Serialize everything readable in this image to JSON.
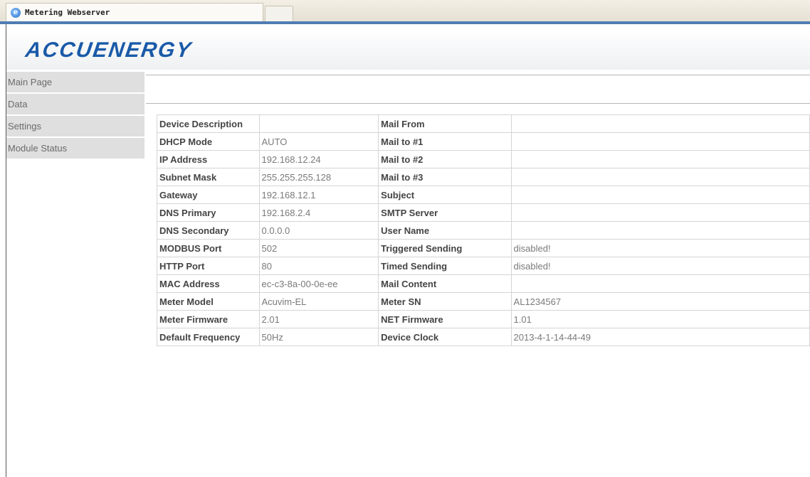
{
  "browser": {
    "tab_title": "Metering Webserver",
    "tab_icon": "browser-logo-icon"
  },
  "brand": {
    "logo_text": "ACCUENERGY",
    "logo_color": "#1a5aa8"
  },
  "nav": {
    "items": [
      "Main Page",
      "Data",
      "Settings",
      "Module Status"
    ]
  },
  "device_table": {
    "rows": [
      {
        "l1": "Device Description",
        "v1": "",
        "l2": "Mail From",
        "v2": ""
      },
      {
        "l1": "DHCP Mode",
        "v1": "AUTO",
        "l2": "Mail to #1",
        "v2": ""
      },
      {
        "l1": "IP Address",
        "v1": "192.168.12.24",
        "l2": "Mail to #2",
        "v2": ""
      },
      {
        "l1": "Subnet Mask",
        "v1": "255.255.255.128",
        "l2": "Mail to #3",
        "v2": ""
      },
      {
        "l1": "Gateway",
        "v1": "192.168.12.1",
        "l2": "Subject",
        "v2": ""
      },
      {
        "l1": "DNS Primary",
        "v1": "192.168.2.4",
        "l2": "SMTP Server",
        "v2": ""
      },
      {
        "l1": "DNS Secondary",
        "v1": "0.0.0.0",
        "l2": "User Name",
        "v2": ""
      },
      {
        "l1": "MODBUS Port",
        "v1": "502",
        "l2": "Triggered Sending",
        "v2": "disabled!"
      },
      {
        "l1": "HTTP Port",
        "v1": "80",
        "l2": "Timed Sending",
        "v2": "disabled!"
      },
      {
        "l1": "MAC Address",
        "v1": "ec-c3-8a-00-0e-ee",
        "l2": "Mail Content",
        "v2": ""
      },
      {
        "l1": "Meter Model",
        "v1": "Acuvim-EL",
        "l2": "Meter SN",
        "v2": "AL1234567"
      },
      {
        "l1": "Meter Firmware",
        "v1": "2.01",
        "l2": "NET Firmware",
        "v2": "1.01"
      },
      {
        "l1": "Default Frequency",
        "v1": "50Hz",
        "l2": "Device Clock",
        "v2": "2013-4-1-14-44-49"
      }
    ]
  }
}
